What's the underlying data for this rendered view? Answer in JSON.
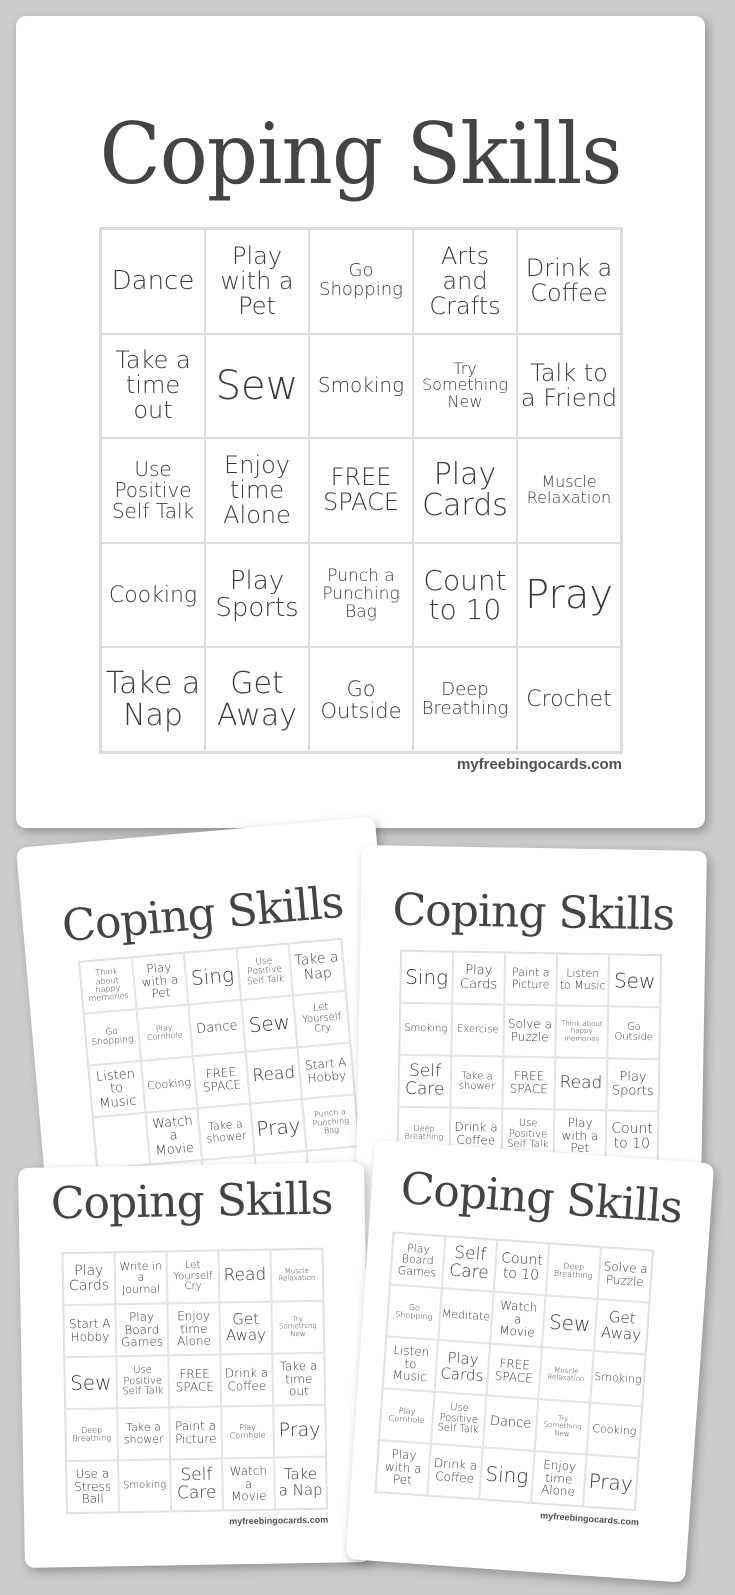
{
  "page": {
    "watermark": "myfreebingocards.com"
  },
  "cards": [
    {
      "id": "main",
      "title": "Coping Skills",
      "cells": [
        {
          "text": "Dance",
          "size": 26
        },
        {
          "text": "Play with a Pet",
          "size": 24
        },
        {
          "text": "Go Shopping",
          "size": 18
        },
        {
          "text": "Arts and Crafts",
          "size": 24
        },
        {
          "text": "Drink a Coffee",
          "size": 24
        },
        {
          "text": "Take a time out",
          "size": 24
        },
        {
          "text": "Sew",
          "size": 40
        },
        {
          "text": "Smoking",
          "size": 20
        },
        {
          "text": "Try Something New",
          "size": 16
        },
        {
          "text": "Talk to a Friend",
          "size": 24
        },
        {
          "text": "Use Positive Self Talk",
          "size": 20
        },
        {
          "text": "Enjoy time Alone",
          "size": 24
        },
        {
          "text": "FREE SPACE",
          "size": 24
        },
        {
          "text": "Play Cards",
          "size": 30
        },
        {
          "text": "Muscle Relaxation",
          "size": 16
        },
        {
          "text": "Cooking",
          "size": 22
        },
        {
          "text": "Play Sports",
          "size": 26
        },
        {
          "text": "Punch a Punching Bag",
          "size": 17
        },
        {
          "text": "Count to 10",
          "size": 28
        },
        {
          "text": "Pray",
          "size": 40
        },
        {
          "text": "Take a Nap",
          "size": 30
        },
        {
          "text": "Get Away",
          "size": 30
        },
        {
          "text": "Go Outside",
          "size": 21
        },
        {
          "text": "Deep Breathing",
          "size": 18
        },
        {
          "text": "Crochet",
          "size": 22
        }
      ]
    },
    {
      "id": "top-left",
      "title": "Coping Skills",
      "cells": [
        {
          "text": "Think about happy memories",
          "size": 8
        },
        {
          "text": "Play with a Pet",
          "size": 12
        },
        {
          "text": "Sing",
          "size": 20
        },
        {
          "text": "Use Positive Self Talk",
          "size": 9
        },
        {
          "text": "Take a Nap",
          "size": 14
        },
        {
          "text": "Go Shopping",
          "size": 9
        },
        {
          "text": "Play Cornhole",
          "size": 8
        },
        {
          "text": "Dance",
          "size": 13
        },
        {
          "text": "Sew",
          "size": 20
        },
        {
          "text": "Let Yourself Cry",
          "size": 10
        },
        {
          "text": "Listen to Music",
          "size": 13
        },
        {
          "text": "Cooking",
          "size": 11
        },
        {
          "text": "FREE SPACE",
          "size": 12
        },
        {
          "text": "Read",
          "size": 17
        },
        {
          "text": "Start A Hobby",
          "size": 12
        },
        {
          "text": "",
          "size": 12
        },
        {
          "text": "Watch a Movie",
          "size": 13
        },
        {
          "text": "Take a shower",
          "size": 11
        },
        {
          "text": "Pray",
          "size": 20
        },
        {
          "text": "Punch a Punching Bag",
          "size": 8
        },
        {
          "text": "",
          "size": 12
        },
        {
          "text": "",
          "size": 12
        },
        {
          "text": "",
          "size": 12
        },
        {
          "text": "",
          "size": 12
        },
        {
          "text": "",
          "size": 12
        }
      ]
    },
    {
      "id": "top-right",
      "title": "Coping Skills",
      "cells": [
        {
          "text": "Sing",
          "size": 20
        },
        {
          "text": "Play Cards",
          "size": 13
        },
        {
          "text": "Paint a Picture",
          "size": 11
        },
        {
          "text": "Listen to Music",
          "size": 11
        },
        {
          "text": "Sew",
          "size": 20
        },
        {
          "text": "Smoking",
          "size": 10
        },
        {
          "text": "Exercise",
          "size": 10
        },
        {
          "text": "Solve a Puzzle",
          "size": 12
        },
        {
          "text": "Think about happy memories",
          "size": 7
        },
        {
          "text": "Go Outside",
          "size": 10
        },
        {
          "text": "Self Care",
          "size": 17
        },
        {
          "text": "Take a shower",
          "size": 10
        },
        {
          "text": "FREE SPACE",
          "size": 12
        },
        {
          "text": "Read",
          "size": 17
        },
        {
          "text": "Play Sports",
          "size": 13
        },
        {
          "text": "Deep Breathing",
          "size": 8
        },
        {
          "text": "Drink a Coffee",
          "size": 12
        },
        {
          "text": "Use Positive Self Talk",
          "size": 10
        },
        {
          "text": "Play with a Pet",
          "size": 12
        },
        {
          "text": "Count to 10",
          "size": 14
        },
        {
          "text": "",
          "size": 12
        },
        {
          "text": "",
          "size": 12
        },
        {
          "text": "",
          "size": 12
        },
        {
          "text": "",
          "size": 12
        },
        {
          "text": "",
          "size": 12
        }
      ]
    },
    {
      "id": "bottom-left",
      "title": "Coping Skills",
      "cells": [
        {
          "text": "Play Cards",
          "size": 14
        },
        {
          "text": "Write in a Journal",
          "size": 11
        },
        {
          "text": "Let Yourself Cry",
          "size": 10
        },
        {
          "text": "Read",
          "size": 17
        },
        {
          "text": "Muscle Relaxation",
          "size": 7
        },
        {
          "text": "Start A Hobby",
          "size": 12
        },
        {
          "text": "Play Board Games",
          "size": 12
        },
        {
          "text": "Enjoy time Alone",
          "size": 12
        },
        {
          "text": "Get Away",
          "size": 15
        },
        {
          "text": "Try Something New",
          "size": 7
        },
        {
          "text": "Sew",
          "size": 20
        },
        {
          "text": "Use Positive Self Talk",
          "size": 10
        },
        {
          "text": "FREE SPACE",
          "size": 12
        },
        {
          "text": "Drink a Coffee",
          "size": 12
        },
        {
          "text": "Take a time out",
          "size": 12
        },
        {
          "text": "Deep Breathing",
          "size": 8
        },
        {
          "text": "Take a shower",
          "size": 11
        },
        {
          "text": "Paint a Picture",
          "size": 12
        },
        {
          "text": "Play Cornhole",
          "size": 8
        },
        {
          "text": "Pray",
          "size": 19
        },
        {
          "text": "Use a Stress Ball",
          "size": 12
        },
        {
          "text": "Smoking",
          "size": 10
        },
        {
          "text": "Self Care",
          "size": 17
        },
        {
          "text": "Watch a Movie",
          "size": 12
        },
        {
          "text": "Take a Nap",
          "size": 15
        }
      ]
    },
    {
      "id": "bottom-right",
      "title": "Coping Skills",
      "cells": [
        {
          "text": "Play Board Games",
          "size": 11
        },
        {
          "text": "Self Care",
          "size": 17
        },
        {
          "text": "Count to 10",
          "size": 14
        },
        {
          "text": "Deep Breathing",
          "size": 8
        },
        {
          "text": "Solve a Puzzle",
          "size": 12
        },
        {
          "text": "Go Shopping",
          "size": 8
        },
        {
          "text": "Meditate",
          "size": 11
        },
        {
          "text": "Watch a Movie",
          "size": 12
        },
        {
          "text": "Sew",
          "size": 20
        },
        {
          "text": "Get Away",
          "size": 15
        },
        {
          "text": "Listen to Music",
          "size": 12
        },
        {
          "text": "Play Cards",
          "size": 15
        },
        {
          "text": "FREE SPACE",
          "size": 12
        },
        {
          "text": "Muscle Relaxation",
          "size": 7
        },
        {
          "text": "Smoking",
          "size": 11
        },
        {
          "text": "Play Cornhole",
          "size": 8
        },
        {
          "text": "Use Positive Self Talk",
          "size": 10
        },
        {
          "text": "Dance",
          "size": 13
        },
        {
          "text": "Try Something New",
          "size": 7
        },
        {
          "text": "Cooking",
          "size": 11
        },
        {
          "text": "Play with a Pet",
          "size": 12
        },
        {
          "text": "Drink a Coffee",
          "size": 12
        },
        {
          "text": "Sing",
          "size": 20
        },
        {
          "text": "Enjoy time Alone",
          "size": 12
        },
        {
          "text": "Pray",
          "size": 20
        }
      ]
    }
  ]
}
